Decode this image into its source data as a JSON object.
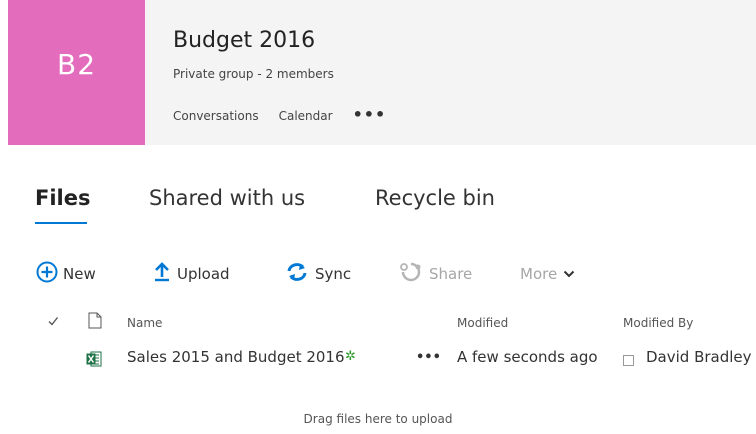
{
  "group": {
    "tile_text": "B2",
    "title": "Budget 2016",
    "subtitle": "Private group - 2 members",
    "nav": [
      "Conversations",
      "Calendar"
    ],
    "more": "•••"
  },
  "tabs": [
    {
      "label": "Files",
      "active": true
    },
    {
      "label": "Shared with us",
      "active": false
    },
    {
      "label": "Recycle bin",
      "active": false
    }
  ],
  "toolbar": {
    "new_label": "New",
    "upload_label": "Upload",
    "sync_label": "Sync",
    "share_label": "Share",
    "more_label": "More"
  },
  "columns": {
    "name": "Name",
    "modified": "Modified",
    "modified_by": "Modified By"
  },
  "files": [
    {
      "name": "Sales 2015 and Budget 2016",
      "ellipsis": "•••",
      "modified": "A few seconds ago",
      "modified_by": "David Bradley",
      "icon": "excel-file-icon",
      "is_new": true
    }
  ],
  "drop_hint": "Drag files here to upload",
  "colors": {
    "tile": "#e36cbd",
    "accent": "#0078d4",
    "header_bg": "#f4f4f4",
    "excel_green": "#1e7145",
    "new_badge": "#2c9a2c"
  }
}
